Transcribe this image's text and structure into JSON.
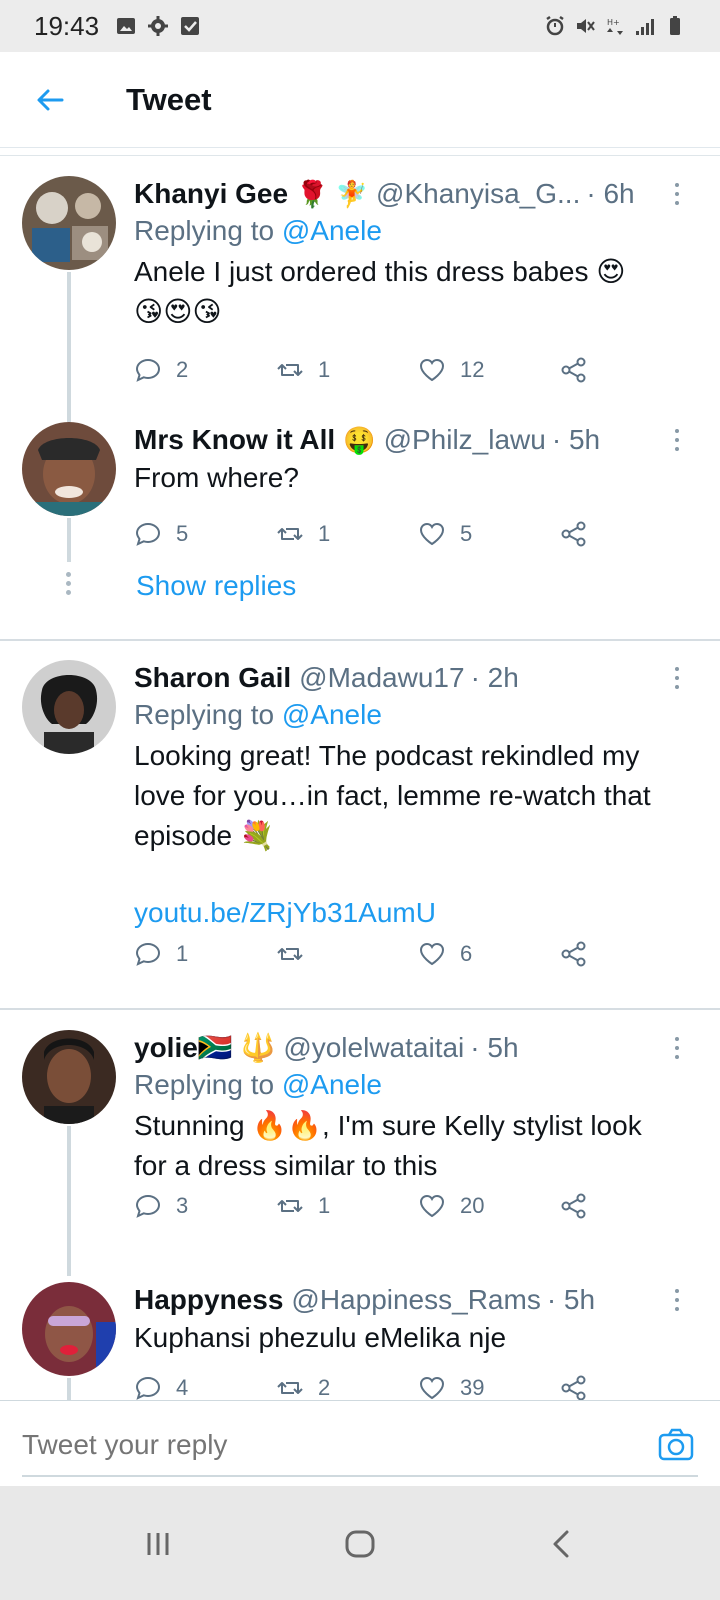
{
  "status_bar": {
    "time": "19:43"
  },
  "header": {
    "title": "Tweet"
  },
  "tweets": [
    {
      "name": "Khanyi Gee",
      "emoji": "🌹 🧚",
      "handle": "@Khanyisa_G...",
      "time": "· 6h",
      "reply_prefix": "Replying to",
      "reply_to": "@Anele",
      "text": "Anele I just ordered this dress babes 😍",
      "text2": "😘😍😘",
      "counts": {
        "reply": "2",
        "retweet": "1",
        "like": "12"
      }
    },
    {
      "name": "Mrs Know it All",
      "emoji": "🤑",
      "handle": "@Philz_lawu",
      "time": "· 5h",
      "text": "From where?",
      "counts": {
        "reply": "5",
        "retweet": "1",
        "like": "5"
      }
    },
    {
      "name": "Sharon Gail",
      "handle": "@Madawu17",
      "time": "· 2h",
      "reply_prefix": "Replying to",
      "reply_to": "@Anele",
      "text_line1": "Looking great! The podcast rekindled my",
      "text_line2": "love for you…in fact, lemme re-watch that",
      "text_line3": "episode  💐",
      "link": "youtu.be/ZRjYb31AumU",
      "counts": {
        "reply": "1",
        "retweet": "",
        "like": "6"
      }
    },
    {
      "name": "yolie🇿🇦 🔱",
      "handle": "@yolelwataitai",
      "time": "· 5h",
      "reply_prefix": "Replying to",
      "reply_to": "@Anele",
      "text_line1": "Stunning 🔥🔥, I'm sure Kelly stylist look",
      "text_line2": "for a dress similar to this",
      "counts": {
        "reply": "3",
        "retweet": "1",
        "like": "20"
      }
    },
    {
      "name": "Happyness",
      "handle": "@Happiness_Rams",
      "time": "· 5h",
      "text": "Kuphansi phezulu eMelika nje",
      "counts": {
        "reply": "4",
        "retweet": "2",
        "like": "39"
      }
    }
  ],
  "show_replies": "Show replies",
  "reply_bar": {
    "placeholder": "Tweet your reply"
  },
  "colors": {
    "accent": "#1d9bf0",
    "secondary_text": "#5b7083",
    "divider": "#cfd9de"
  },
  "icons": [
    "back-arrow-icon",
    "reply-icon",
    "retweet-icon",
    "like-icon",
    "share-icon",
    "more-icon",
    "camera-icon",
    "recent-apps-icon",
    "home-icon",
    "back-nav-icon"
  ]
}
